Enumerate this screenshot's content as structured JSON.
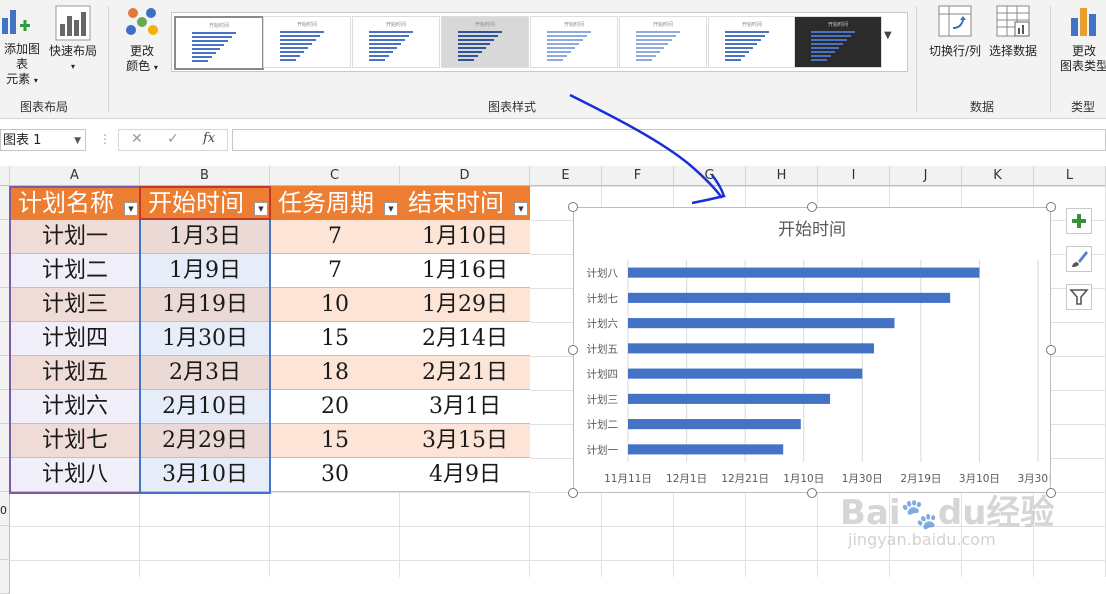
{
  "ribbon": {
    "add_element_label_1": "添加图表",
    "add_element_label_2": "元素",
    "quick_layout_label": "快速布局",
    "change_color_label_1": "更改",
    "change_color_label_2": "颜色",
    "group_layout": "图表布局",
    "group_styles": "图表样式",
    "switch_row_col_label": "切换行/列",
    "select_data_label": "选择数据",
    "group_data": "数据",
    "change_type_label_1": "更改",
    "change_type_label_2": "图表类型",
    "group_type": "类型",
    "style_thumb_title": "开始时间"
  },
  "formula_bar": {
    "name_box": "图表 1",
    "fx": "fx",
    "cancel": "✕",
    "confirm": "✓"
  },
  "columns": [
    "A",
    "B",
    "C",
    "D",
    "E",
    "F",
    "G",
    "H",
    "I",
    "J",
    "K",
    "L"
  ],
  "row_numbers": [
    "0"
  ],
  "table": {
    "headers": [
      "计划名称",
      "开始时间",
      "任务周期",
      "结束时间"
    ],
    "rows": [
      [
        "计划一",
        "1月3日",
        "7",
        "1月10日"
      ],
      [
        "计划二",
        "1月9日",
        "7",
        "1月16日"
      ],
      [
        "计划三",
        "1月19日",
        "10",
        "1月29日"
      ],
      [
        "计划四",
        "1月30日",
        "15",
        "2月14日"
      ],
      [
        "计划五",
        "2月3日",
        "18",
        "2月21日"
      ],
      [
        "计划六",
        "2月10日",
        "20",
        "3月1日"
      ],
      [
        "计划七",
        "2月29日",
        "15",
        "3月15日"
      ],
      [
        "计划八",
        "3月10日",
        "30",
        "4月9日"
      ]
    ]
  },
  "colors": {
    "header_orange": "#ed7d31",
    "row_odd_a": "#f0dcd6",
    "row_even_a": "#f0eef8",
    "row_odd_b": "#ead9d4",
    "row_even_b": "#e6edf8",
    "row_odd_cd": "#fce4d6",
    "bar_blue": "#4472c4",
    "annotation_arrow": "#1a2fd6"
  },
  "chart_data": {
    "type": "bar",
    "orientation": "horizontal",
    "title": "开始时间",
    "categories": [
      "计划一",
      "计划二",
      "计划三",
      "计划四",
      "计划五",
      "计划六",
      "计划七",
      "计划八"
    ],
    "values": [
      "1月3日",
      "1月9日",
      "1月19日",
      "1月30日",
      "2月3日",
      "2月10日",
      "2月29日",
      "3月10日"
    ],
    "xlim": [
      "11月11日",
      "3月30日"
    ],
    "x_ticks": [
      "11月11日",
      "12月1日",
      "12月21日",
      "1月10日",
      "1月30日",
      "2月19日",
      "3月10日",
      "3月30日"
    ],
    "grid": true,
    "legend": "none"
  },
  "watermark": {
    "logo": "Baidu经验",
    "url": "jingyan.baidu.com"
  }
}
